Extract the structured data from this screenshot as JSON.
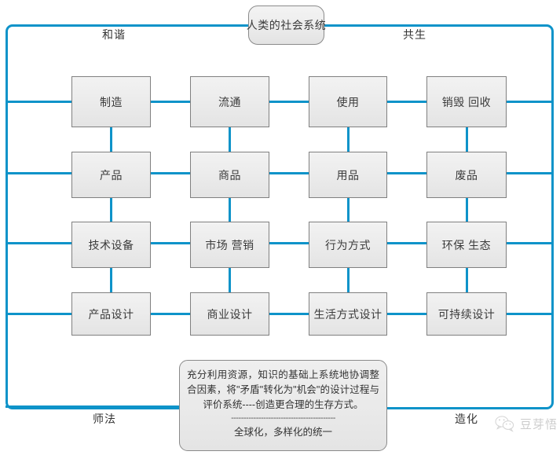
{
  "diagram": {
    "title_capsule": "人类的社会系统",
    "corner_labels": {
      "top_left": "和谐",
      "top_right": "共生",
      "bottom_left": "师法",
      "bottom_right": "造化"
    },
    "columns": 4,
    "rows": [
      {
        "row_index": 1,
        "nodes": [
          "制造",
          "流通",
          "使用",
          "销毁 回收"
        ]
      },
      {
        "row_index": 2,
        "nodes": [
          "产品",
          "商品",
          "用品",
          "废品"
        ]
      },
      {
        "row_index": 3,
        "nodes": [
          "技术设备",
          "市场 营销",
          "行为方式",
          "环保 生态"
        ]
      },
      {
        "row_index": 4,
        "nodes": [
          "产品设计",
          "商业设计",
          "生活方式设计",
          "可持续设计"
        ]
      }
    ],
    "statement": {
      "paragraph": "充分利用资源，知识的基础上系统地协调整合因素，将\"矛盾\"转化为\"机会\"的设计过程与评价系统----创造更合理的生存方式。",
      "divider": "------------------------------------------",
      "tagline": "全球化，多样化的统一"
    },
    "watermark": {
      "icon": "wechat-icon",
      "text": "豆芽悟"
    },
    "colors": {
      "frame_line": "#0e93c9",
      "node_border": "#808080",
      "node_fill": "#ececec",
      "text": "#333333",
      "watermark_text": "#999999"
    }
  }
}
